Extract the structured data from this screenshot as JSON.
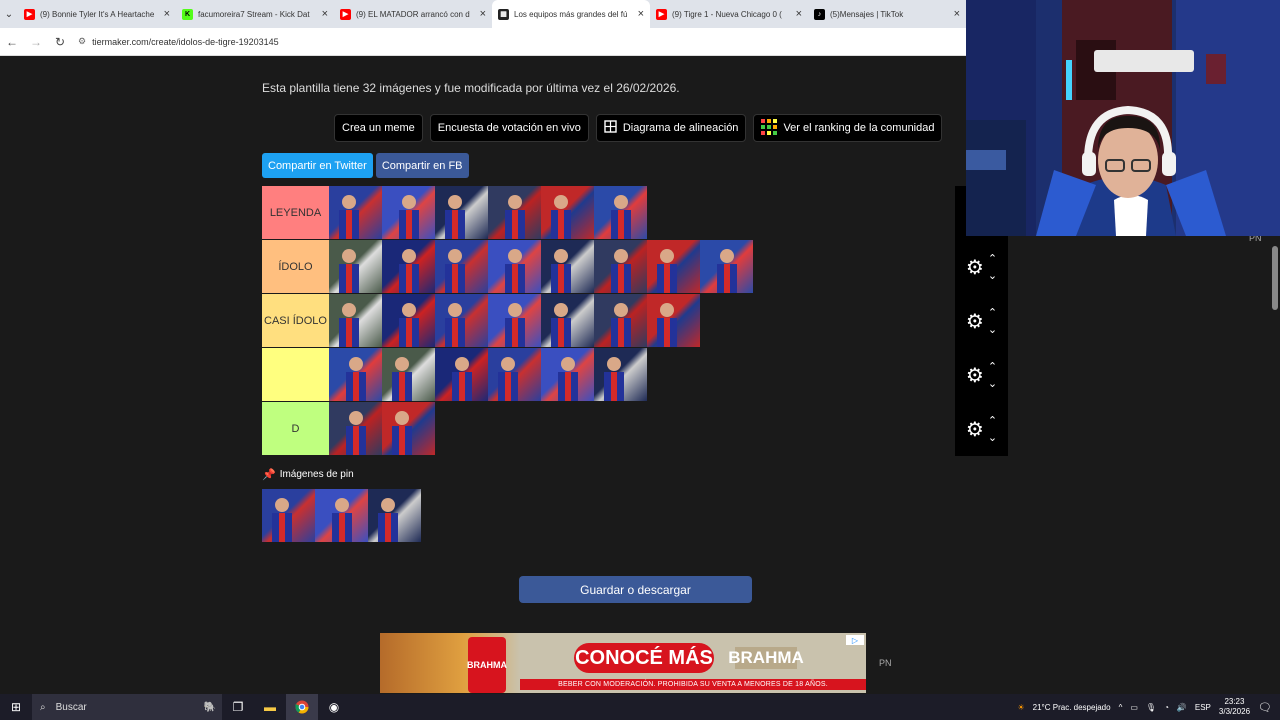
{
  "browser": {
    "tabs": [
      {
        "title": "(9) Bonnie Tyler It's A Heartache",
        "icon": "youtube-icon",
        "color": "#ff0000",
        "active": false
      },
      {
        "title": "facumoreira7 Stream - Kick Dat",
        "icon": "kick-icon",
        "color": "#53fc18",
        "active": false
      },
      {
        "title": "(9) EL MATADOR arrancó con d",
        "icon": "youtube-icon",
        "color": "#ff0000",
        "active": false
      },
      {
        "title": "Los equipos más grandes del fú",
        "icon": "site-icon",
        "color": "#222222",
        "active": true
      },
      {
        "title": "(9) Tigre 1 - Nueva Chicago 0 (",
        "icon": "youtube-icon",
        "color": "#ff0000",
        "active": false
      },
      {
        "title": "(5)Mensajes | TikTok",
        "icon": "tiktok-icon",
        "color": "#000000",
        "active": false
      }
    ],
    "url": "tiermaker.com/create/idolos-de-tigre-19203145"
  },
  "page": {
    "info": "Esta plantilla tiene 32 imágenes y fue modificada por última vez el 26/02/2026.",
    "buttons": [
      "Crea un meme",
      "Encuesta de votación en vivo",
      "Diagrama de alineación",
      "Ver el ranking de la comunidad"
    ],
    "share": {
      "twitter": "Compartir en Twitter",
      "facebook": "Compartir en FB"
    },
    "tiers": [
      {
        "label": "LEYENDA",
        "color": "#ff7f7f",
        "count": 6
      },
      {
        "label": "ÍDOLO",
        "color": "#ffbf7f",
        "count": 8
      },
      {
        "label": "CASI ÍDOLO",
        "color": "#ffdf7f",
        "count": 7
      },
      {
        "label": "",
        "color": "#ffff7f",
        "count": 6
      },
      {
        "label": "D",
        "color": "#bfff7f",
        "count": 2
      }
    ],
    "pinned_title": "Imágenes de pin",
    "pinned_count": 3,
    "save_label": "Guardar o descargar",
    "pn_label": "PN"
  },
  "ad": {
    "can_text": "BRAHMA",
    "headline": "CONOCÉ MÁS",
    "logo": "BRAHMA",
    "disclaimer": "BEBER CON MODERACIÓN. PROHIBIDA SU VENTA A MENORES DE 18 AÑOS."
  },
  "taskbar": {
    "search_placeholder": "Buscar",
    "weather": "21°C  Prac. despejado",
    "lang": "ESP",
    "time": "23:23",
    "date": "3/3/2026"
  }
}
